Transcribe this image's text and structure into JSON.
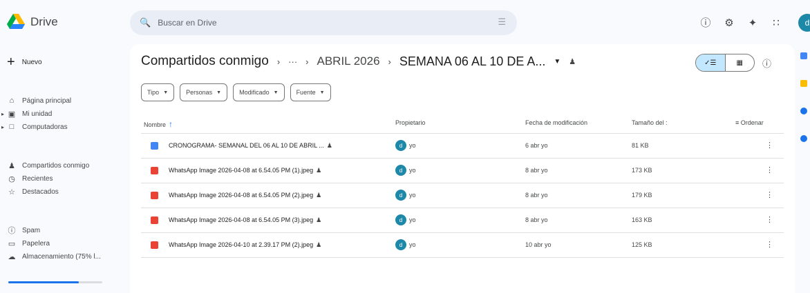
{
  "app": {
    "name": "Drive",
    "avatar_letter": "d"
  },
  "search": {
    "placeholder": "Buscar en Drive"
  },
  "sidebar": {
    "new_label": "Nuevo",
    "items": [
      {
        "label": "Página principal",
        "icon": "home-icon"
      },
      {
        "label": "Mi unidad",
        "icon": "drive-icon"
      },
      {
        "label": "Computadoras",
        "icon": "computer-icon"
      },
      {
        "label": "Compartidos conmigo",
        "icon": "shared-icon"
      },
      {
        "label": "Recientes",
        "icon": "clock-icon"
      },
      {
        "label": "Destacados",
        "icon": "star-icon"
      },
      {
        "label": "Spam",
        "icon": "spam-icon"
      },
      {
        "label": "Papelera",
        "icon": "trash-icon"
      },
      {
        "label": "Almacenamiento (75% l...",
        "icon": "cloud-icon"
      }
    ],
    "storage_used_fraction": 0.75
  },
  "breadcrumb": {
    "root": "Compartidos conmigo",
    "ellipsis": "···",
    "middle": "ABRIL 2026",
    "current": "SEMANA 06 AL 10 DE A..."
  },
  "filters": [
    "Tipo",
    "Personas",
    "Modificado",
    "Fuente"
  ],
  "table": {
    "headers": {
      "name": "Nombre",
      "owner": "Propietario",
      "modified": "Fecha de modificación",
      "size": "Tamaño del :",
      "sort": "Ordenar"
    },
    "rows": [
      {
        "type": "doc",
        "name": "CRONOGRAMA- SEMANAL DEL 06 AL 10 DE ABRIL ...",
        "owner": "yo",
        "modified": "6 abr yo",
        "size": "81 KB"
      },
      {
        "type": "img",
        "name": "WhatsApp Image 2026-04-08 at 6.54.05 PM (1).jpeg",
        "owner": "yo",
        "modified": "8 abr yo",
        "size": "173 KB"
      },
      {
        "type": "img",
        "name": "WhatsApp Image 2026-04-08 at 6.54.05 PM (2).jpeg",
        "owner": "yo",
        "modified": "8 abr yo",
        "size": "179 KB"
      },
      {
        "type": "img",
        "name": "WhatsApp Image 2026-04-08 at 6.54.05 PM (3).jpeg",
        "owner": "yo",
        "modified": "8 abr yo",
        "size": "163 KB"
      },
      {
        "type": "img",
        "name": "WhatsApp Image 2026-04-10 at 2.39.17 PM (2).jpeg",
        "owner": "yo",
        "modified": "10 abr yo",
        "size": "125 KB"
      }
    ]
  },
  "colors": {
    "accent": "#1a73e8",
    "image_icon": "#ea4335",
    "doc_icon": "#4285f4",
    "avatar": "#1e88a8"
  }
}
